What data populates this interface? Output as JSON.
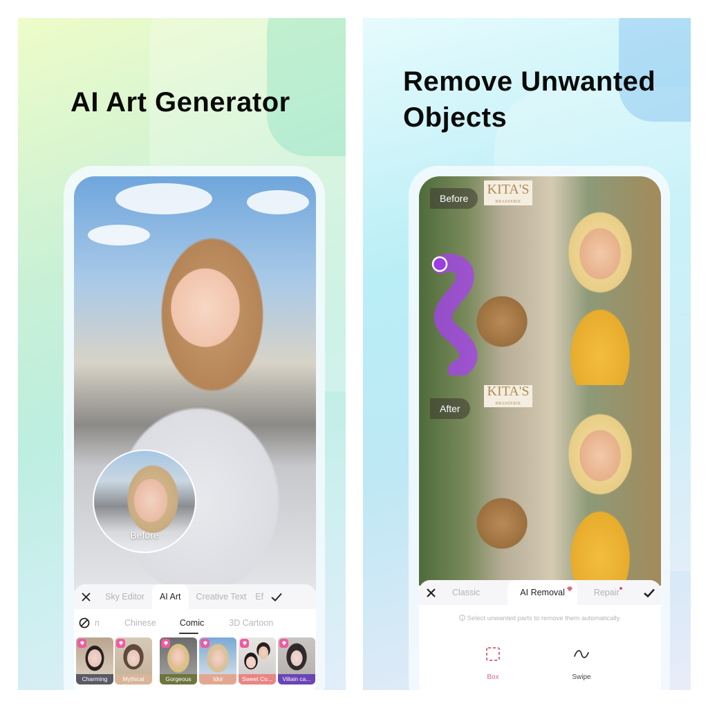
{
  "panels": [
    {
      "headline": "AI Art Generator",
      "phone": {
        "before_label": "Before",
        "toolbar": {
          "close_icon": "close-icon",
          "tabs": [
            {
              "label": "Sky Editor",
              "active": false
            },
            {
              "label": "AI Art",
              "active": true
            },
            {
              "label": "Creative Text",
              "active": false
            },
            {
              "label": "Ef",
              "active": false
            }
          ],
          "confirm_icon": "check-icon"
        },
        "style_tabs": {
          "none_icon": "no-effect-icon",
          "items": [
            {
              "label": "n",
              "active": false
            },
            {
              "label": "Chinese",
              "active": false
            },
            {
              "label": "Comic",
              "active": true
            },
            {
              "label": "3D Cartoon",
              "active": false
            }
          ]
        },
        "styles": [
          {
            "label": "Charming",
            "caption_color": "#5a5a66",
            "premium": true
          },
          {
            "label": "Mythical",
            "caption_color": "#d7b69a",
            "premium": true
          },
          {
            "label": "Gorgeous",
            "caption_color": "#6f7440",
            "premium": true
          },
          {
            "label": "Idol",
            "caption_color": "#e2a793",
            "premium": true
          },
          {
            "label": "Sweet Co...",
            "caption_color": "#e98585",
            "premium": true
          },
          {
            "label": "Villain ca...",
            "caption_color": "#6a44b5",
            "premium": true
          }
        ]
      }
    },
    {
      "headline_line1": "Remove Unwanted",
      "headline_line2": "Objects",
      "phone": {
        "sign_text": "KITA'S",
        "sign_sub": "BRASSERIE",
        "before_label": "Before",
        "after_label": "After",
        "toolbar": {
          "close_icon": "close-icon",
          "tabs": [
            {
              "label": "Classic",
              "active": false
            },
            {
              "label": "AI Removal",
              "active": true,
              "premium": true
            },
            {
              "label": "Repair",
              "active": false,
              "dot": true
            }
          ],
          "confirm_icon": "check-icon"
        },
        "hint": "Select unwanted parts to remove them automatically.",
        "tools": [
          {
            "label": "Box",
            "icon": "dashed-box-icon",
            "active": true
          },
          {
            "label": "Swipe",
            "icon": "swipe-wave-icon",
            "active": false
          }
        ]
      }
    }
  ],
  "colors": {
    "accent_pink": "#e0667f",
    "brush_purple": "#a445e8",
    "premium_badge": "#ef5aa0"
  }
}
